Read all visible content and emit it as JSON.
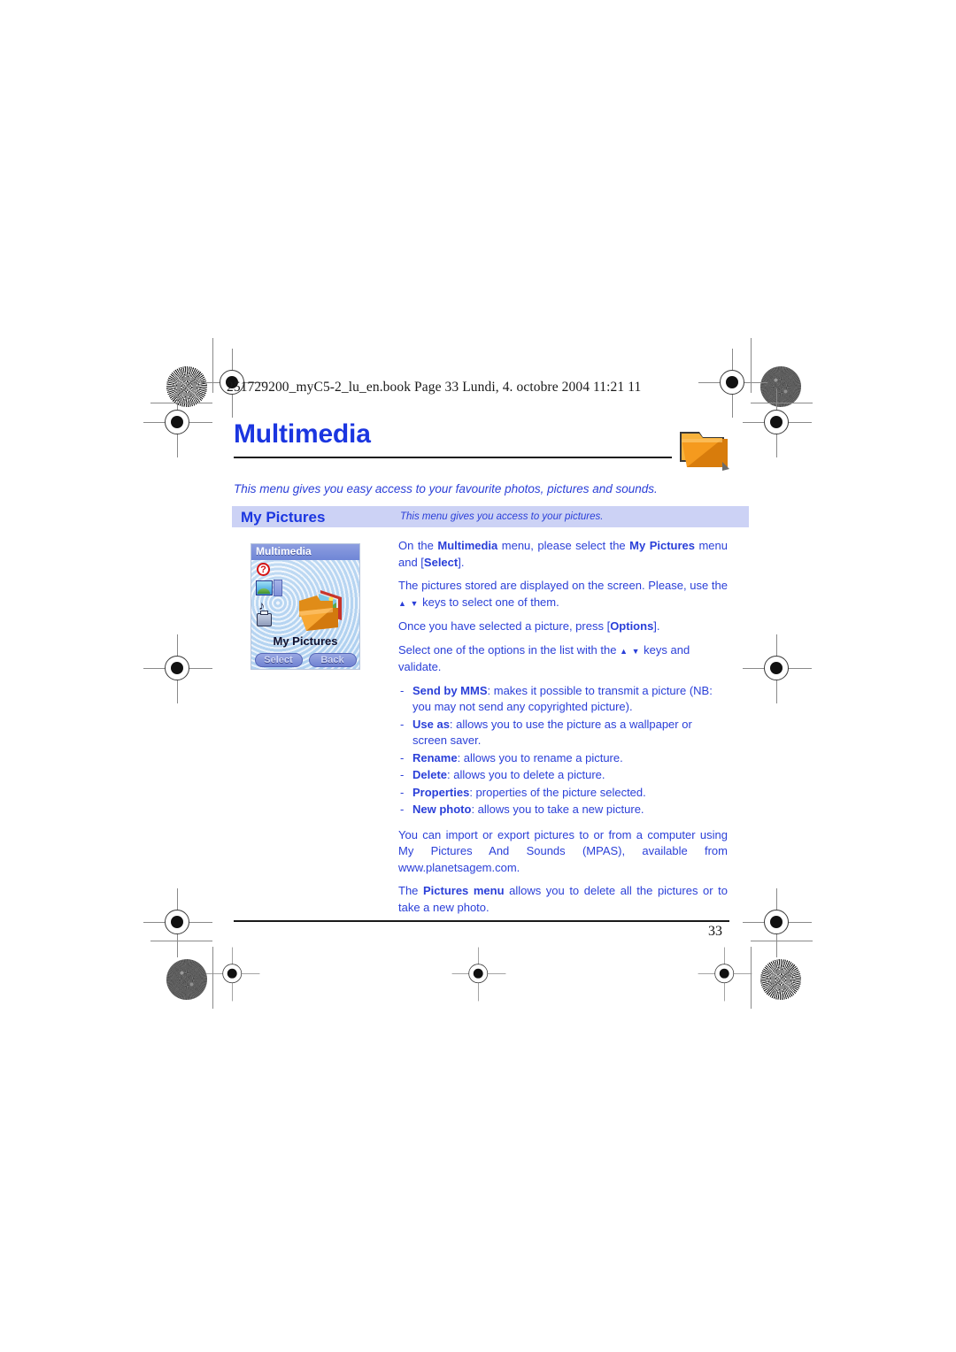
{
  "document": {
    "running_header": "251729200_myC5-2_lu_en.book  Page 33  Lundi, 4. octobre 2004  11:21 11",
    "chapter_title": "Multimedia",
    "chapter_icon": "folder-icon",
    "chapter_intro": "This menu gives you easy access to your favourite photos, pictures and sounds.",
    "page_number": "33"
  },
  "section": {
    "band_title": "My Pictures",
    "band_subtitle": "This menu gives you access to your pictures."
  },
  "phone_screenshot": {
    "status_title": "Multimedia",
    "caption": "My Pictures",
    "softkey_left": "Select",
    "softkey_right": "Back",
    "help_glyph": "?",
    "note_glyph": "♪",
    "icons": [
      "help-icon",
      "pictures-icon",
      "scrollbar-icon",
      "music-note-icon",
      "printer-icon",
      "open-folder-photos-icon"
    ]
  },
  "body": {
    "para1": {
      "prefix": "On the ",
      "bold1": "Multimedia",
      "mid": " menu, please select the ",
      "bold2": "My Pictures",
      "mid2": " menu and [",
      "bold3": "Select",
      "suffix": "]."
    },
    "para2": {
      "line": "The pictures stored are displayed on the screen. Please, use the",
      "after_keys": "keys to select one of them."
    },
    "para3": {
      "prefix": "Once you have selected a picture, press [",
      "bold": "Options",
      "suffix": "]."
    },
    "para4": {
      "prefix": "Select one of the options in the list with the",
      "suffix": "keys and validate."
    },
    "options": [
      {
        "dash": "-",
        "term": "Send by MMS",
        "desc": ": makes it possible to transmit a picture (NB: you may not send any copyrighted picture)."
      },
      {
        "dash": "-",
        "term": "Use as",
        "desc": ": allows you to use the picture as a wallpaper or screen saver."
      },
      {
        "dash": "-",
        "term": "Rename",
        "desc": ": allows you to rename a picture."
      },
      {
        "dash": "-",
        "term": "Delete",
        "desc": ": allows you to delete a picture."
      },
      {
        "dash": "-",
        "term": "Properties",
        "desc": ": properties of the picture selected."
      },
      {
        "dash": "-",
        "term": "New photo",
        "desc": ": allows you to take a new picture."
      }
    ],
    "para5": "You can import or export pictures to or from a computer using My Pictures And Sounds (MPAS), available from www.planetsagem.com.",
    "para6": {
      "prefix": "The ",
      "bold": "Pictures menu",
      "suffix": " allows you to delete all the pictures or to take a new photo."
    }
  },
  "colors": {
    "heading_blue": "#1b36e0",
    "body_blue": "#2a3fd8",
    "band_background": "#ccd2f5",
    "folder_orange": "#f59a1e",
    "rule_black": "#1a1a1a"
  }
}
